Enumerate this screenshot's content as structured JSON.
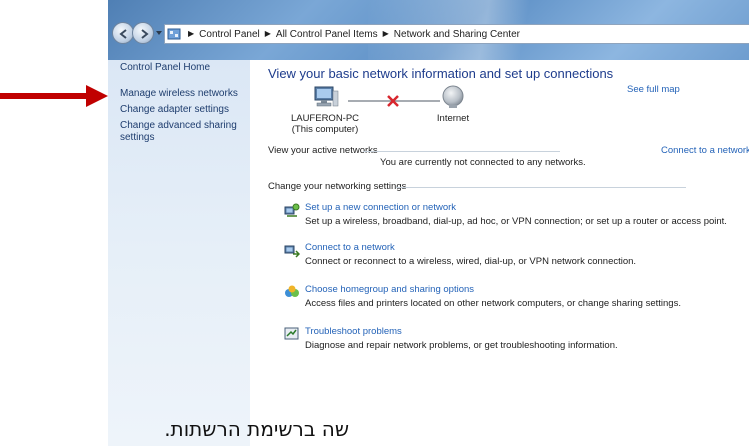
{
  "address_bar": {
    "crumbs": [
      "Control Panel",
      "All Control Panel Items",
      "Network and Sharing Center"
    ]
  },
  "sidebar": {
    "home": "Control Panel Home",
    "links": [
      "Manage wireless networks",
      "Change adapter settings",
      "Change advanced sharing settings"
    ]
  },
  "main": {
    "title": "View your basic network information and set up connections",
    "see_full_map": "See full map",
    "computer_name": "LAUFERON-PC",
    "computer_sub": "(This computer)",
    "internet_label": "Internet",
    "active_networks_label": "View your active networks",
    "connect_link": "Connect to a network",
    "not_connected": "You are currently not connected to any networks.",
    "settings_label": "Change your networking settings",
    "tasks": [
      {
        "link": "Set up a new connection or network",
        "desc": "Set up a wireless, broadband, dial-up, ad hoc, or VPN connection; or set up a router or access point."
      },
      {
        "link": "Connect to a network",
        "desc": "Connect or reconnect to a wireless, wired, dial-up, or VPN network connection."
      },
      {
        "link": "Choose homegroup and sharing options",
        "desc": "Access files and printers located on other network computers, or change sharing settings."
      },
      {
        "link": "Troubleshoot problems",
        "desc": "Diagnose and repair network problems, or get troubleshooting information."
      }
    ]
  },
  "caption": "שה ברשימת הרשתות.",
  "colors": {
    "arrow": "#c00000",
    "link": "#2463b8",
    "title": "#1e3c8c",
    "error_x": "#d8262e"
  }
}
